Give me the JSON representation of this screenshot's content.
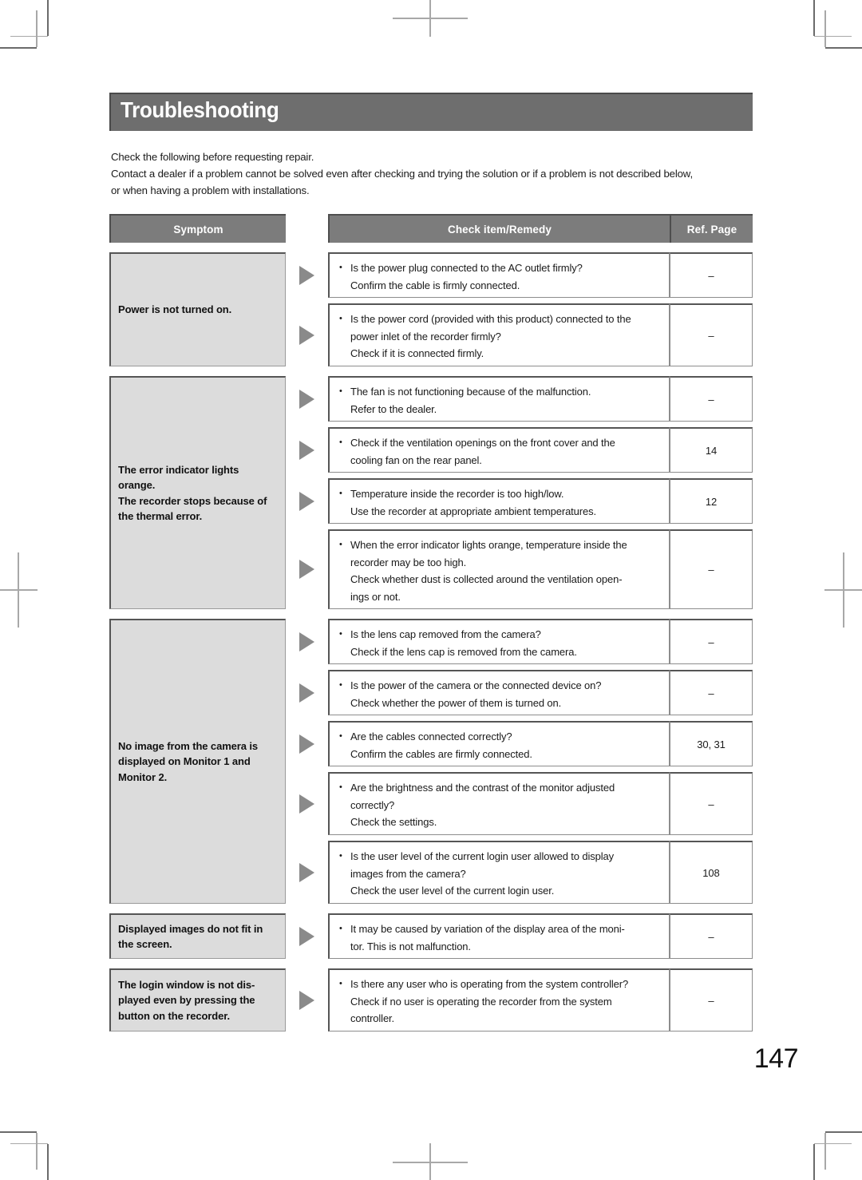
{
  "document": {
    "heading": "Troubleshooting",
    "page_number": "147",
    "intro_lines": [
      "Check the following before requesting repair.",
      "Contact a dealer if a problem cannot be solved even after checking and trying the solution or if a problem is not described below,",
      "or when having a problem with installations."
    ]
  },
  "colors": {
    "heading_band": "#6e6e6e",
    "table_header": "#7c7c7c",
    "symptom_cell": "#dcdcdc",
    "arrow": "#8a8a8a",
    "crop_mark": "#6b6b6b"
  },
  "table": {
    "headers": {
      "symptom": "Symptom",
      "check": "Check item/Remedy",
      "ref": "Ref. Page"
    },
    "groups": [
      {
        "symptom": "Power is not turned on.",
        "rows": [
          {
            "bullet": "Is the power plug connected to the AC outlet firmly?",
            "lines": [
              "Confirm the cable is firmly connected."
            ],
            "ref": "–"
          },
          {
            "bullet": "Is the power cord (provided with this product) connected to the",
            "lines": [
              "power inlet of the recorder firmly?",
              "Check if it is connected firmly."
            ],
            "ref": "–"
          }
        ]
      },
      {
        "symptom": "The error indicator lights orange.\nThe recorder stops because of the thermal error.",
        "rows": [
          {
            "bullet": "The fan is not functioning because of the malfunction.",
            "lines": [
              "Refer to the dealer."
            ],
            "ref": "–"
          },
          {
            "bullet": "Check if the ventilation openings on the front cover and the",
            "lines": [
              "cooling fan on the rear panel."
            ],
            "ref": "14"
          },
          {
            "bullet": "Temperature inside the recorder is too high/low.",
            "lines": [
              "Use the recorder at appropriate ambient temperatures."
            ],
            "ref": "12"
          },
          {
            "bullet": "When the error indicator lights orange, temperature inside the",
            "lines": [
              "recorder may be too high.",
              "Check whether dust is collected around the ventilation open-",
              "ings or not."
            ],
            "ref": "–"
          }
        ]
      },
      {
        "symptom": "No image from the camera is displayed on Monitor 1 and Monitor 2.",
        "rows": [
          {
            "bullet": "Is the lens cap removed from the camera?",
            "lines": [
              "Check if the lens cap is removed from the camera."
            ],
            "ref": "–"
          },
          {
            "bullet": "Is the power of the camera or the connected device on?",
            "lines": [
              "Check whether the power of them is turned on."
            ],
            "ref": "–"
          },
          {
            "bullet": "Are the cables connected correctly?",
            "lines": [
              "Confirm the cables are firmly connected."
            ],
            "ref": "30, 31"
          },
          {
            "bullet": "Are the brightness and the contrast of the monitor adjusted",
            "lines": [
              "correctly?",
              "Check the settings."
            ],
            "ref": "–"
          },
          {
            "bullet": "Is the user level of the current login user allowed to display",
            "lines": [
              "images from the camera?",
              "Check the user level of the current login user."
            ],
            "ref": "108"
          }
        ]
      },
      {
        "symptom": "Displayed images do not fit in the screen.",
        "rows": [
          {
            "bullet": "It may be caused by variation of the display area of the moni-",
            "lines": [
              "tor. This is not malfunction."
            ],
            "ref": "–"
          }
        ]
      },
      {
        "symptom": "The login window is not dis-played even by pressing the button on the recorder.",
        "rows": [
          {
            "bullet": "Is there any user who is operating from the system controller?",
            "lines": [
              "Check if no user is operating the recorder from the system",
              "controller."
            ],
            "ref": "–"
          }
        ]
      }
    ]
  }
}
